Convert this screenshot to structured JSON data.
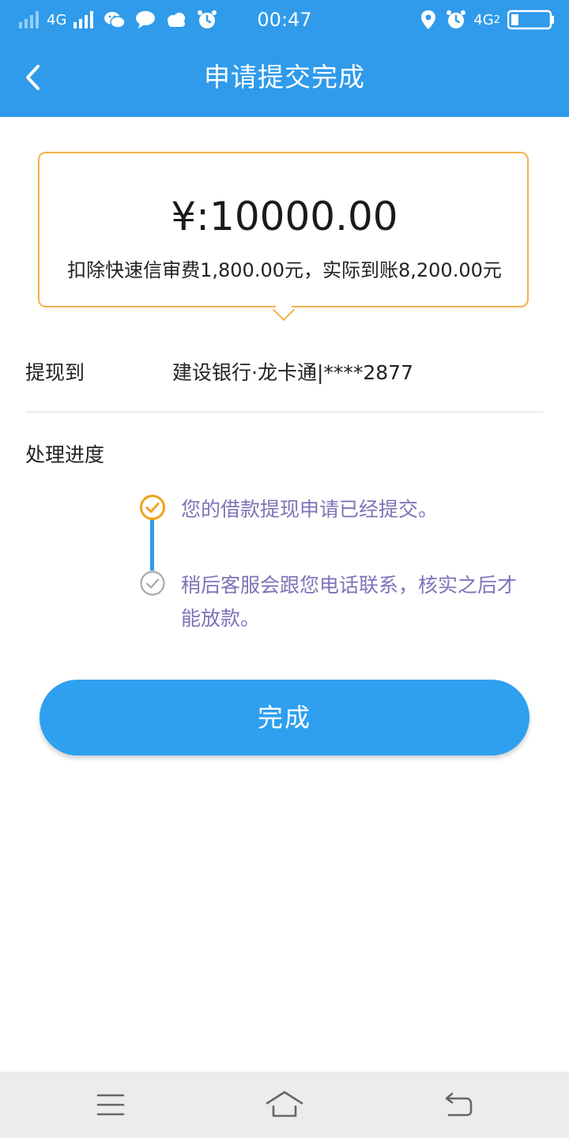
{
  "status_bar": {
    "network_left": "4G",
    "time": "00:47",
    "network_right": "4G",
    "sim_index": "2",
    "icons": [
      "signal-icon",
      "signal-icon",
      "wechat-icon",
      "message-icon",
      "cloud-icon",
      "alarm-icon",
      "location-icon",
      "alarm-icon",
      "battery-icon"
    ]
  },
  "header": {
    "title": "申请提交完成",
    "back_icon": "chevron-left-icon"
  },
  "amount": {
    "value": "¥:10000.00",
    "note": "扣除快速信审费1,800.00元，实际到账8,200.00元"
  },
  "withdraw": {
    "label": "提现到",
    "value": "建设银行·龙卡通|****2877"
  },
  "progress": {
    "label": "处理进度",
    "steps": [
      {
        "text": "您的借款提现申请已经提交。",
        "status": "done",
        "icon": "check-circle-icon"
      },
      {
        "text": "稍后客服会跟您电话联系，核实之后才能放款。",
        "status": "pending",
        "icon": "check-circle-icon"
      }
    ]
  },
  "done_button": {
    "label": "完成"
  },
  "nav": {
    "icons": [
      "menu-icon",
      "home-icon",
      "back-icon"
    ]
  },
  "colors": {
    "primary": "#2f9bea",
    "button": "#2ea0ef",
    "card_border": "#f5b04a",
    "step_done": "#f0a21b",
    "step_pending": "#a9a9a9",
    "step_text": "#7b75b8"
  }
}
